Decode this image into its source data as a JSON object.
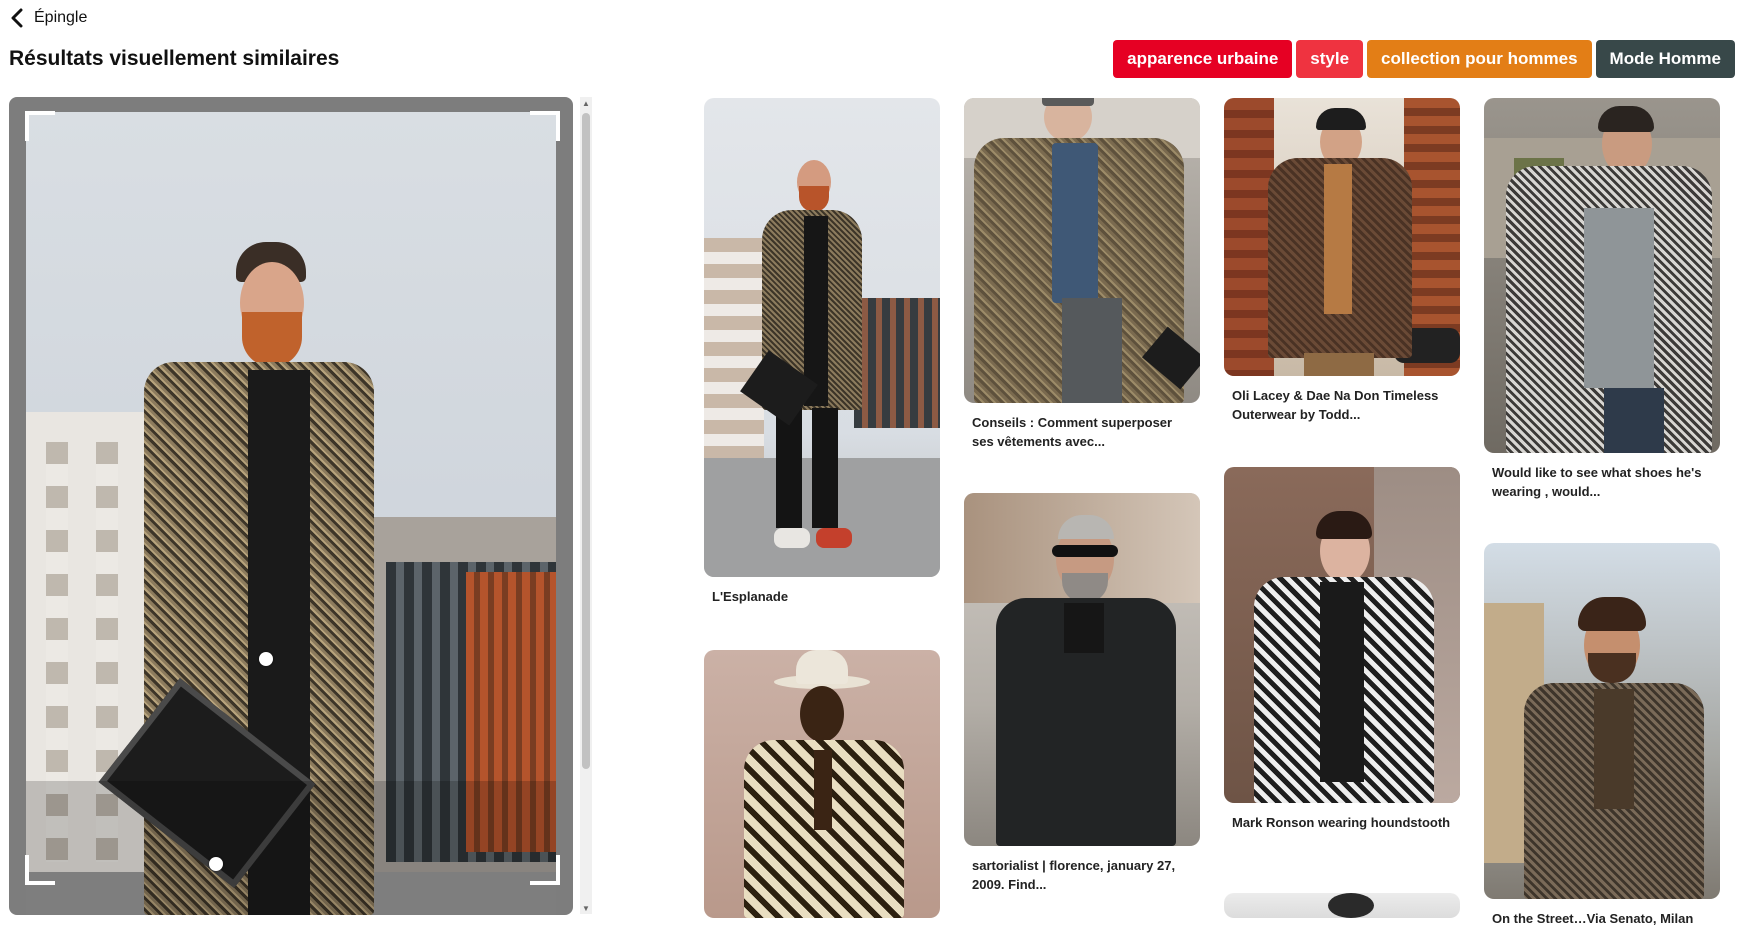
{
  "header": {
    "back_label": "Épingle",
    "title": "Résultats visuellement similaires"
  },
  "tags": [
    {
      "label": "apparence urbaine",
      "color": "#e60023"
    },
    {
      "label": "style",
      "color": "#ef3340"
    },
    {
      "label": "collection pour hommes",
      "color": "#e37e16"
    },
    {
      "label": "Mode Homme",
      "color": "#384849"
    }
  ],
  "icons": {
    "back": "chevron-left-icon",
    "scroll_up": "▲",
    "scroll_down": "▼"
  },
  "pins": [
    {
      "title": "L'Esplanade"
    },
    {
      "title": ""
    },
    {
      "title": "Conseils : Comment superposer ses vêtements avec..."
    },
    {
      "title": "sartorialist | florence, january 27, 2009. Find..."
    },
    {
      "title": "Oli Lacey & Dae Na Don Timeless Outerwear by Todd..."
    },
    {
      "title": "Mark Ronson wearing houndstooth"
    },
    {
      "title": ""
    },
    {
      "title": "Would like to see what shoes he's wearing , would..."
    },
    {
      "title": "On the Street…Via Senato, Milan"
    }
  ]
}
